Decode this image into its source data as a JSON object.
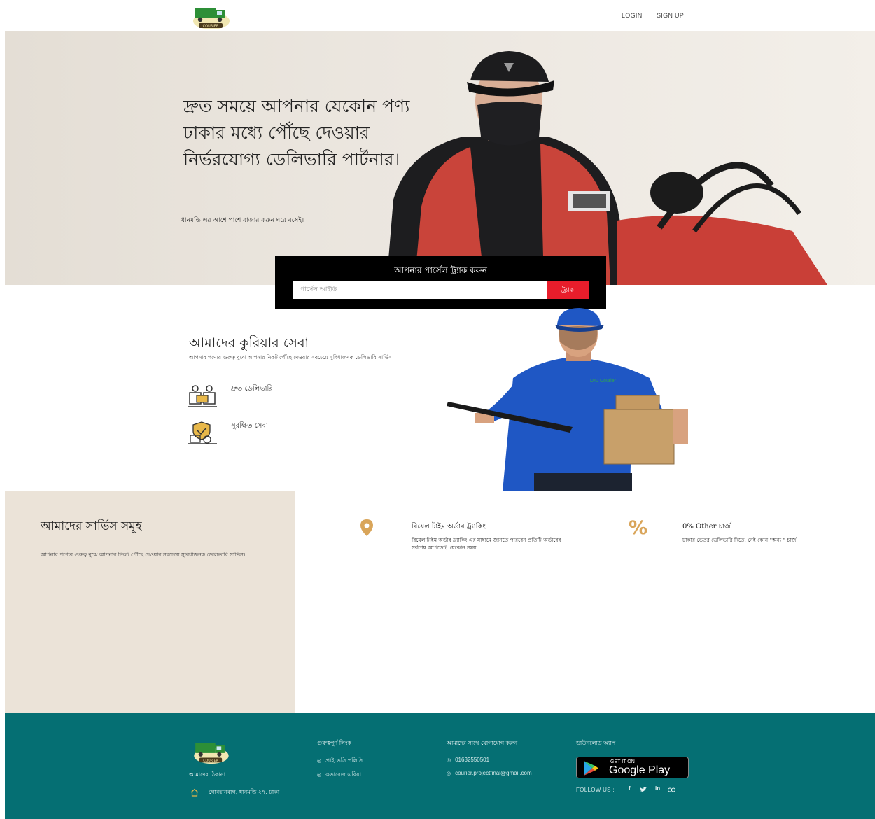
{
  "header": {
    "logo_alt": "DIU COURIER",
    "login": "LOGIN",
    "signup": "SIGN UP"
  },
  "hero": {
    "title": "দ্রুত সময়ে আপনার যেকোন পণ্য ঢাকার মধ্যে পৌঁছে দেওয়ার নির্ভরযোগ্য ডেলিভারি পার্টনার।",
    "subtitle": "ধানমন্ডি এর আশে পাশে বাজার করুন ঘরে বসেই।"
  },
  "track": {
    "title": "আপনার পার্সেল ট্র্যাক করুন",
    "placeholder": "পার্সেল আইডি",
    "button": "ট্র্যাক"
  },
  "courier_service": {
    "title": "আমাদের কুরিয়ার সেবা",
    "description": "আপনার পণ্যের গুরুত্ব বুঝে আপনার নিকট পৌঁছে দেওয়ার সবচেয়ে সুবিধাজনক ডেলিভারি সার্ভিস।",
    "items": [
      {
        "label": "দ্রুত ডেলিভারি",
        "icon": "fast-delivery-icon"
      },
      {
        "label": "সুরক্ষিত সেবা",
        "icon": "secure-service-icon"
      }
    ],
    "shirt_text": "DIU Courier"
  },
  "services": {
    "title": "আমাদের সার্ভিস সমূহ",
    "description": "আপনার পণ্যের গুরুত্ব বুঝে আপনার নিকট পৌঁছে দেওয়ার সবচেয়ে সুবিধাজনক ডেলিভারি সার্ভিস।",
    "features": [
      {
        "icon": "location-pin-icon",
        "title": "রিয়েল টাইম অর্ডার ট্র্যাকিং",
        "description": "রিয়েল টাইম অর্ডার ট্র্যাকিং এর মাধ্যমে জানতে পারবেন প্রতিটি অর্ডারের সর্বশেষ আপডেট, যেকোন সময়"
      },
      {
        "icon": "percent-icon",
        "icon_text": "%",
        "title": "0% Other চার্জ",
        "description": "ঢাকার ভেতর ডেলিভারি দিতে, নেই কোন \"অন্য \" চার্জ"
      }
    ]
  },
  "footer": {
    "address_title": "আমাদের ঠিকানা",
    "address": "গোবহানবাগ, ধানমন্ডি ২৭, ঢাকা",
    "links_title": "গুরুত্বপূর্ণ লিংক",
    "links": [
      "প্রাইভেসি পলিসি",
      "কভারেজ এরিয়া"
    ],
    "contact_title": "আমাদের সাথে যোগাযোগ করুন",
    "phone": "01632550501",
    "email": "courier.projectfinal@gmail.com",
    "app_title": "ডাউনলোড অ্যাপ",
    "store_top": "GET IT ON",
    "store_name": "Google Play",
    "follow": "FOLLOW US :",
    "social": [
      "f",
      "in"
    ],
    "colors": {
      "bg": "#056f73",
      "accent": "#e81d2b"
    }
  }
}
